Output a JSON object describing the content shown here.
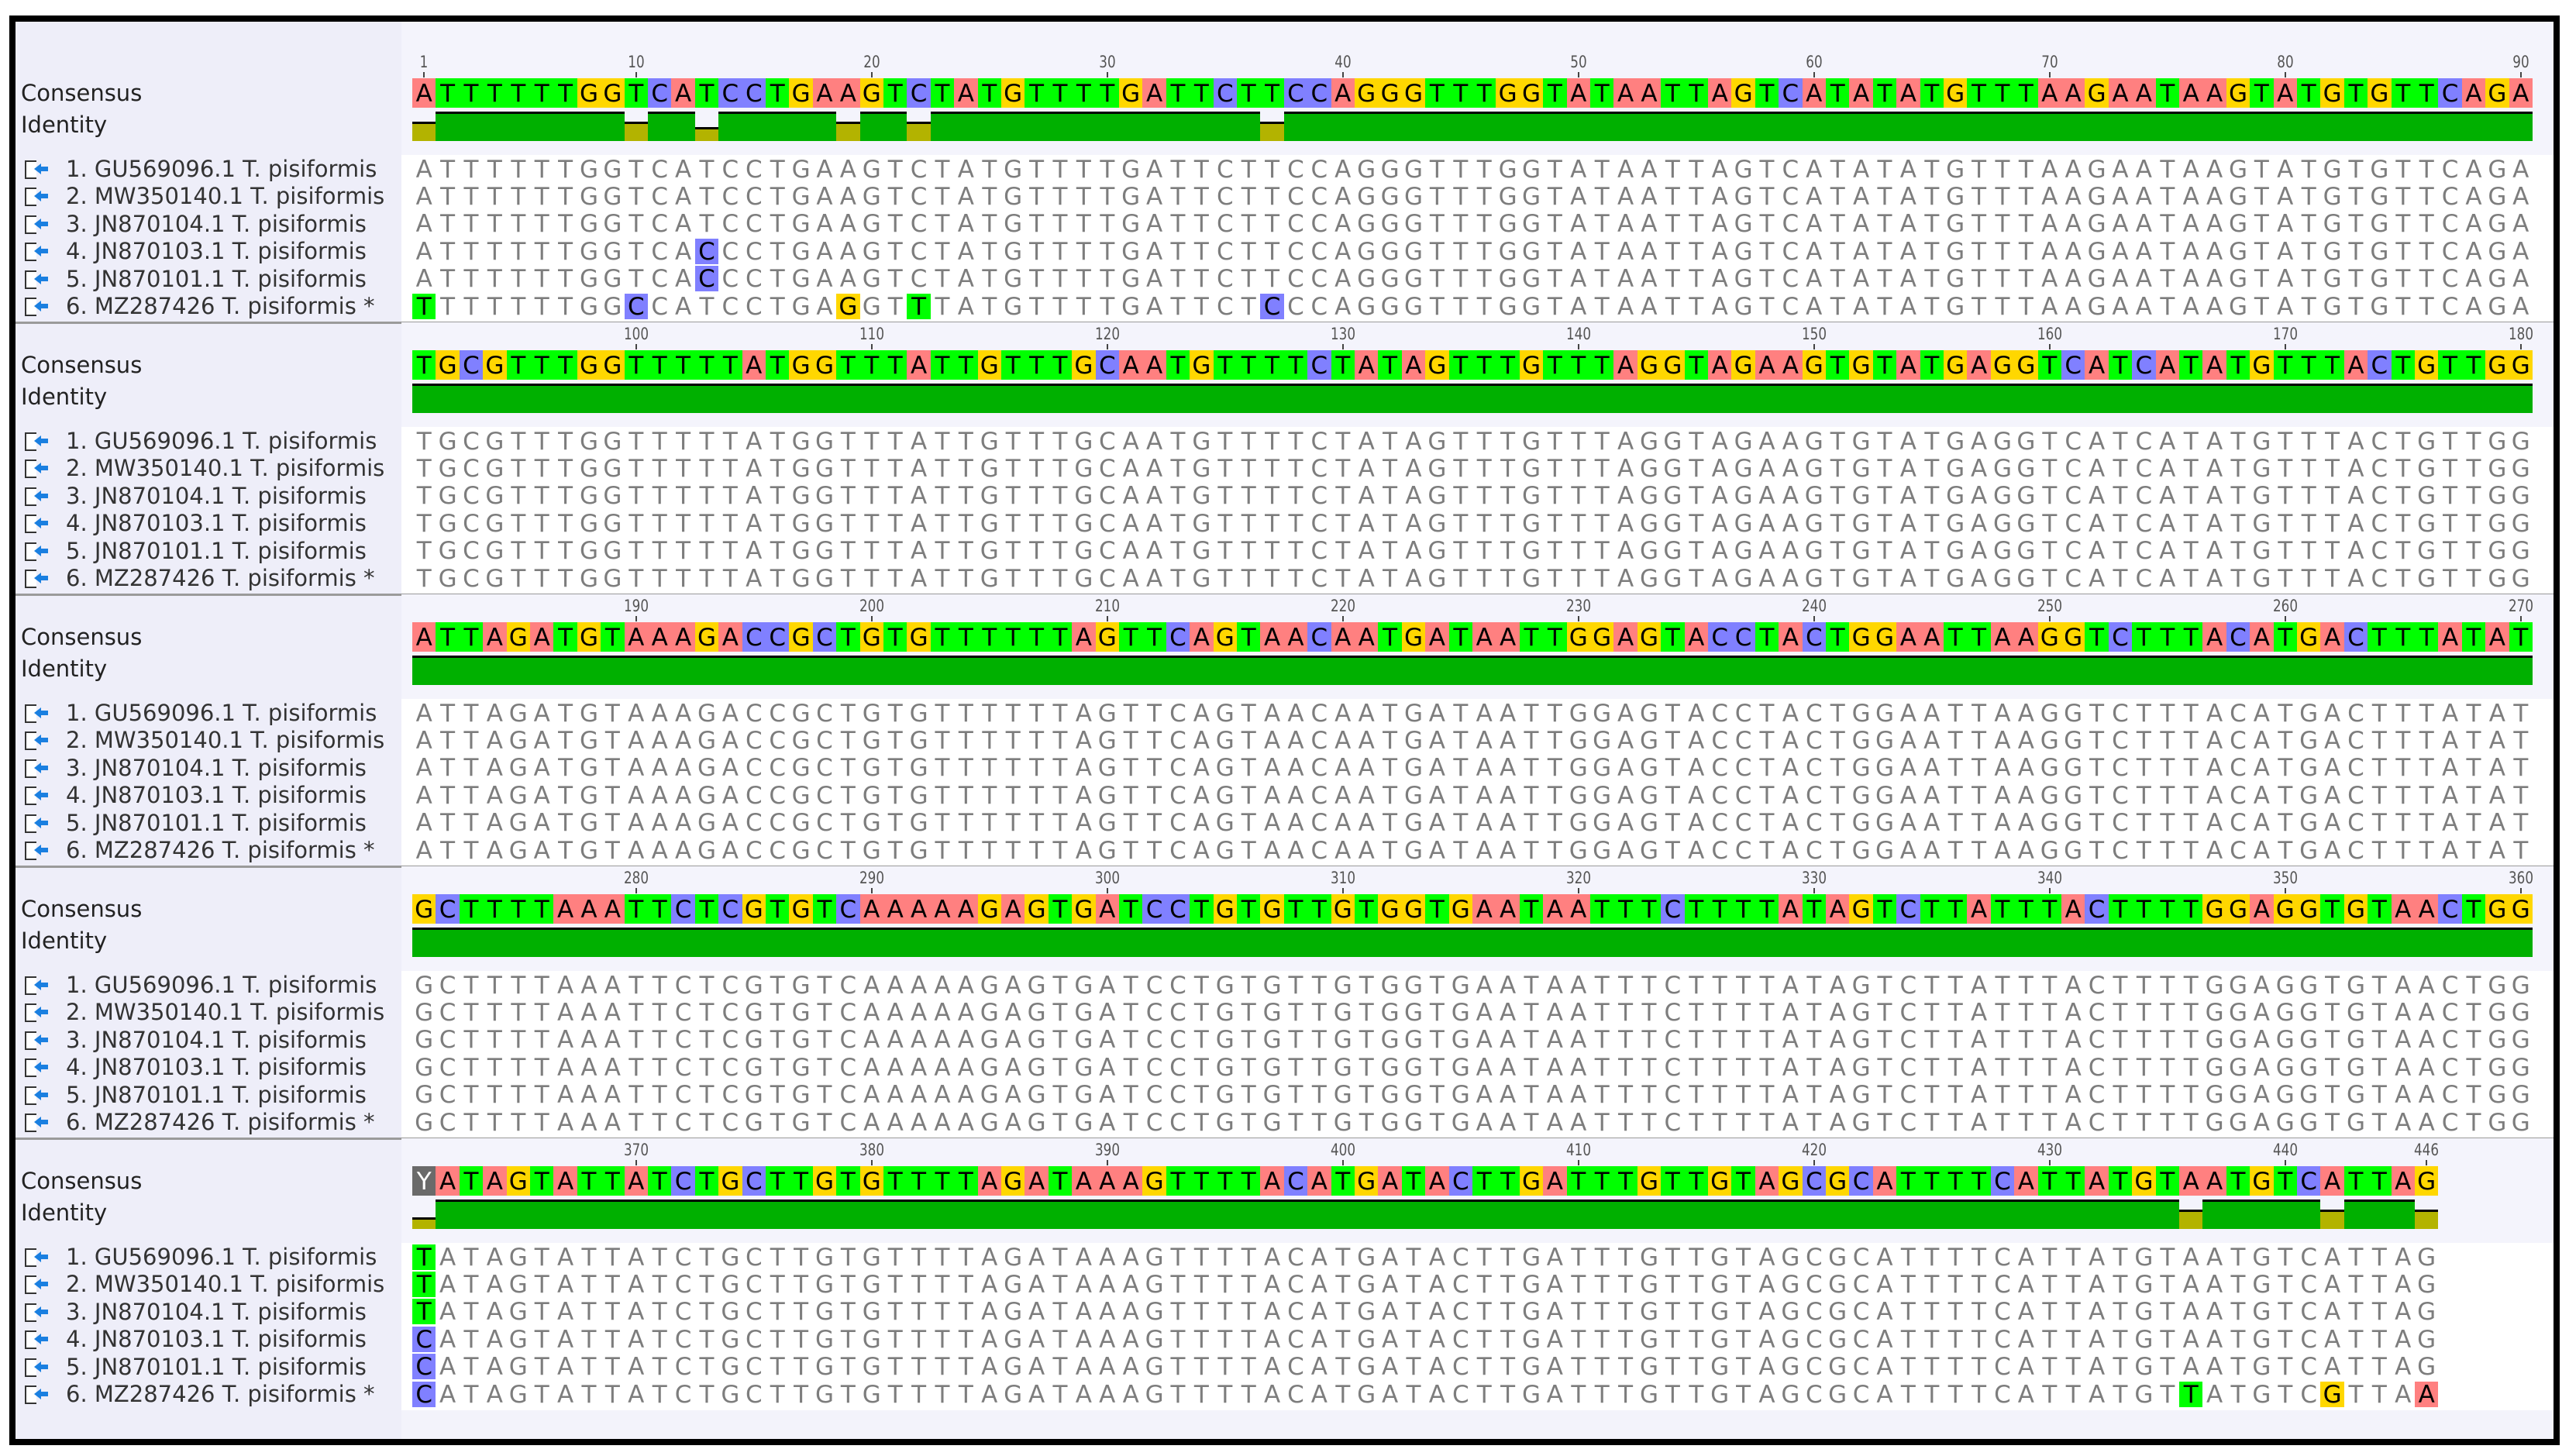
{
  "labels": {
    "consensus": "Consensus",
    "identity": "Identity"
  },
  "colors": {
    "A": "#ff8080",
    "C": "#8080ff",
    "G": "#ffd700",
    "T": "#00ff00",
    "Y": "#6a6a6a",
    "identity_full": "#00b000",
    "identity_partial": "#b3b300"
  },
  "blocks": [
    {
      "start": 1,
      "end": 90,
      "ticks": [
        "1",
        "10",
        "20",
        "30",
        "40",
        "50",
        "60",
        "70",
        "80",
        "90"
      ]
    },
    {
      "start": 91,
      "end": 180,
      "ticks": [
        "100",
        "110",
        "120",
        "130",
        "140",
        "150",
        "160",
        "170",
        "180"
      ]
    },
    {
      "start": 181,
      "end": 270,
      "ticks": [
        "190",
        "200",
        "210",
        "220",
        "230",
        "240",
        "250",
        "260",
        "270"
      ]
    },
    {
      "start": 271,
      "end": 360,
      "ticks": [
        "280",
        "290",
        "300",
        "310",
        "320",
        "330",
        "340",
        "350",
        "360"
      ]
    },
    {
      "start": 361,
      "end": 446,
      "ticks": [
        "370",
        "380",
        "390",
        "400",
        "410",
        "420",
        "430",
        "440",
        "446"
      ]
    }
  ],
  "consensus": [
    "ATTTTTTGGTCATCCTGAAGTCTATGTTTTGATTCTTCCAGGGTTTGGTATAATTAGTCATATATGTTTAAGAATAAGTATGTGTTCAGA",
    "TGCGTTTGGTTTTTATGGTTTATTGTTTGCAATGTTTTCTATAGTTTGTTTAGGTAGAAGTGTATGAGGTCATCATATGTTTACTGTTGG",
    "ATTAGATGTAAAGACCGCTGTGTTTTTTAGTTCAGTAACAATGATAATTGGAGTACCTACTGGAATTAAGGTCTTTACATGACTTTATAT",
    "GCTTTTAAATTCTCGTGTCAAAAAGAGTGATCCTGTGTTGTGGTGAATAATTTCTTTTATAGTCTTATTTACTTTTGGAGGTGTAACTGG",
    "YATAGTATTATCTGCTTGTGTTTTAGATAAAGTTTTACATGATACTTGATTTGTTGTAGCGCATTTTCATTATGTAATGTCATTAG"
  ],
  "sequences": [
    {
      "label": "1. GU569096.1 T. pisiformis",
      "blocks": [
        "ATTTTTTGGTCATCCTGAAGTCTATGTTTTGATTCTTCCAGGGTTTGGTATAATTAGTCATATATGTTTAAGAATAAGTATGTGTTCAGA",
        "TGCGTTTGGTTTTTATGGTTTATTGTTTGCAATGTTTTCTATAGTTTGTTTAGGTAGAAGTGTATGAGGTCATCATATGTTTACTGTTGG",
        "ATTAGATGTAAAGACCGCTGTGTTTTTTAGTTCAGTAACAATGATAATTGGAGTACCTACTGGAATTAAGGTCTTTACATGACTTTATAT",
        "GCTTTTAAATTCTCGTGTCAAAAAGAGTGATCCTGTGTTGTGGTGAATAATTTCTTTTATAGTCTTATTTACTTTTGGAGGTGTAACTGG",
        "TATAGTATTATCTGCTTGTGTTTTAGATAAAGTTTTACATGATACTTGATTTGTTGTAGCGCATTTTCATTATGTAATGTCATTAG"
      ]
    },
    {
      "label": "2. MW350140.1 T. pisiformis",
      "blocks": [
        "ATTTTTTGGTCATCCTGAAGTCTATGTTTTGATTCTTCCAGGGTTTGGTATAATTAGTCATATATGTTTAAGAATAAGTATGTGTTCAGA",
        "TGCGTTTGGTTTTTATGGTTTATTGTTTGCAATGTTTTCTATAGTTTGTTTAGGTAGAAGTGTATGAGGTCATCATATGTTTACTGTTGG",
        "ATTAGATGTAAAGACCGCTGTGTTTTTTAGTTCAGTAACAATGATAATTGGAGTACCTACTGGAATTAAGGTCTTTACATGACTTTATAT",
        "GCTTTTAAATTCTCGTGTCAAAAAGAGTGATCCTGTGTTGTGGTGAATAATTTCTTTTATAGTCTTATTTACTTTTGGAGGTGTAACTGG",
        "TATAGTATTATCTGCTTGTGTTTTAGATAAAGTTTTACATGATACTTGATTTGTTGTAGCGCATTTTCATTATGTAATGTCATTAG"
      ]
    },
    {
      "label": "3. JN870104.1 T. pisiformis",
      "blocks": [
        "ATTTTTTGGTCATCCTGAAGTCTATGTTTTGATTCTTCCAGGGTTTGGTATAATTAGTCATATATGTTTAAGAATAAGTATGTGTTCAGA",
        "TGCGTTTGGTTTTTATGGTTTATTGTTTGCAATGTTTTCTATAGTTTGTTTAGGTAGAAGTGTATGAGGTCATCATATGTTTACTGTTGG",
        "ATTAGATGTAAAGACCGCTGTGTTTTTTAGTTCAGTAACAATGATAATTGGAGTACCTACTGGAATTAAGGTCTTTACATGACTTTATAT",
        "GCTTTTAAATTCTCGTGTCAAAAAGAGTGATCCTGTGTTGTGGTGAATAATTTCTTTTATAGTCTTATTTACTTTTGGAGGTGTAACTGG",
        "TATAGTATTATCTGCTTGTGTTTTAGATAAAGTTTTACATGATACTTGATTTGTTGTAGCGCATTTTCATTATGTAATGTCATTAG"
      ]
    },
    {
      "label": "4. JN870103.1 T. pisiformis",
      "blocks": [
        "ATTTTTTGGTCACCCTGAAGTCTATGTTTTGATTCTTCCAGGGTTTGGTATAATTAGTCATATATGTTTAAGAATAAGTATGTGTTCAGA",
        "TGCGTTTGGTTTTTATGGTTTATTGTTTGCAATGTTTTCTATAGTTTGTTTAGGTAGAAGTGTATGAGGTCATCATATGTTTACTGTTGG",
        "ATTAGATGTAAAGACCGCTGTGTTTTTTAGTTCAGTAACAATGATAATTGGAGTACCTACTGGAATTAAGGTCTTTACATGACTTTATAT",
        "GCTTTTAAATTCTCGTGTCAAAAAGAGTGATCCTGTGTTGTGGTGAATAATTTCTTTTATAGTCTTATTTACTTTTGGAGGTGTAACTGG",
        "CATAGTATTATCTGCTTGTGTTTTAGATAAAGTTTTACATGATACTTGATTTGTTGTAGCGCATTTTCATTATGTAATGTCATTAG"
      ]
    },
    {
      "label": "5. JN870101.1 T. pisiformis",
      "blocks": [
        "ATTTTTTGGTCACCCTGAAGTCTATGTTTTGATTCTTCCAGGGTTTGGTATAATTAGTCATATATGTTTAAGAATAAGTATGTGTTCAGA",
        "TGCGTTTGGTTTTTATGGTTTATTGTTTGCAATGTTTTCTATAGTTTGTTTAGGTAGAAGTGTATGAGGTCATCATATGTTTACTGTTGG",
        "ATTAGATGTAAAGACCGCTGTGTTTTTTAGTTCAGTAACAATGATAATTGGAGTACCTACTGGAATTAAGGTCTTTACATGACTTTATAT",
        "GCTTTTAAATTCTCGTGTCAAAAAGAGTGATCCTGTGTTGTGGTGAATAATTTCTTTTATAGTCTTATTTACTTTTGGAGGTGTAACTGG",
        "CATAGTATTATCTGCTTGTGTTTTAGATAAAGTTTTACATGATACTTGATTTGTTGTAGCGCATTTTCATTATGTAATGTCATTAG"
      ]
    },
    {
      "label": "6. MZ287426 T. pisiformis *",
      "blocks": [
        "TTTTTTTGGCCATCCTGAGGTTTATGTTTTGATTCTCCCAGGGTTTGGTATAATTAGTCATATATGTTTAAGAATAAGTATGTGTTCAGA",
        "TGCGTTTGGTTTTTATGGTTTATTGTTTGCAATGTTTTCTATAGTTTGTTTAGGTAGAAGTGTATGAGGTCATCATATGTTTACTGTTGG",
        "ATTAGATGTAAAGACCGCTGTGTTTTTTAGTTCAGTAACAATGATAATTGGAGTACCTACTGGAATTAAGGTCTTTACATGACTTTATAT",
        "GCTTTTAAATTCTCGTGTCAAAAAGAGTGATCCTGTGTTGTGGTGAATAATTTCTTTTATAGTCTTATTTACTTTTGGAGGTGTAACTGG",
        "CATAGTATTATCTGCTTGTGTTTTAGATAAAGTTTTACATGATACTTGATTTGTTGTAGCGCATTTTCATTATGTTATGTCGTTAA"
      ]
    }
  ]
}
